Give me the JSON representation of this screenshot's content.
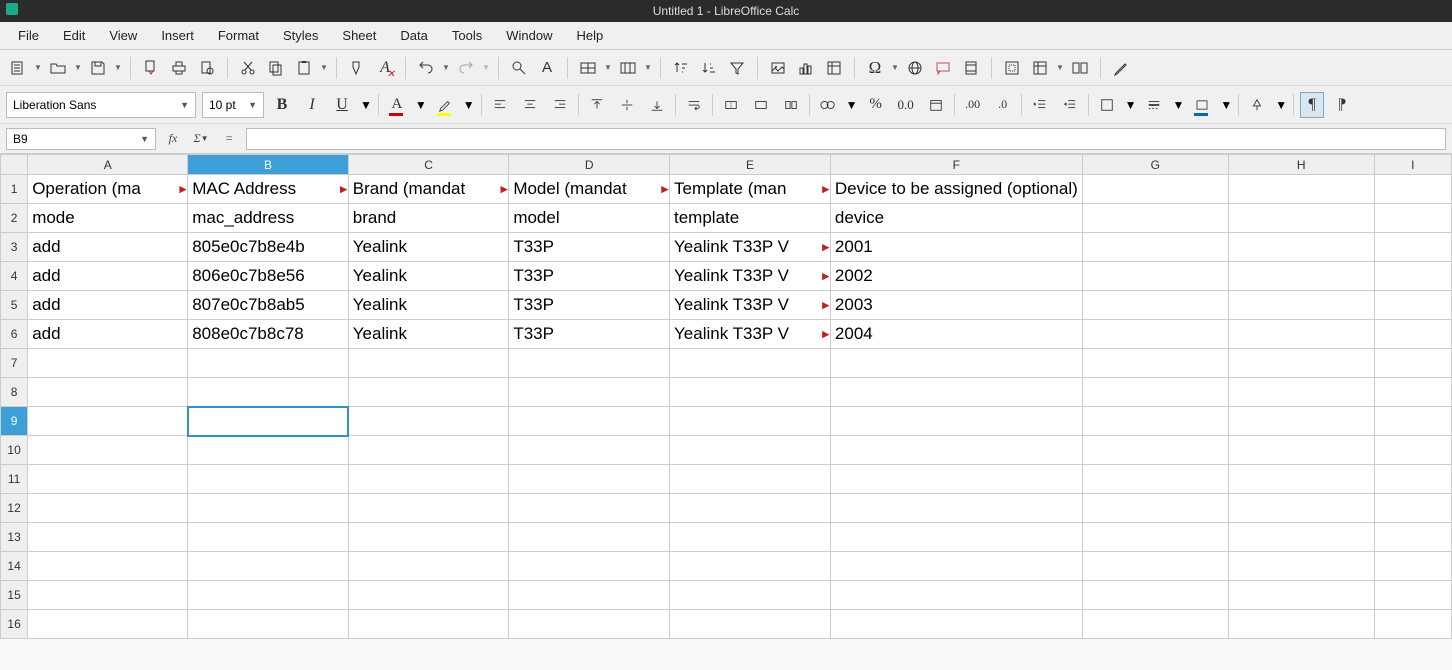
{
  "window": {
    "title": "Untitled 1 - LibreOffice Calc"
  },
  "menu": {
    "items": [
      "File",
      "Edit",
      "View",
      "Insert",
      "Format",
      "Styles",
      "Sheet",
      "Data",
      "Tools",
      "Window",
      "Help"
    ]
  },
  "format": {
    "font_name": "Liberation Sans",
    "font_size": "10 pt"
  },
  "ref": {
    "cell": "B9",
    "formula": ""
  },
  "columns": [
    "A",
    "B",
    "C",
    "D",
    "E",
    "F",
    "G",
    "H",
    "I"
  ],
  "selected": {
    "col": "B",
    "row": 9
  },
  "sheet": {
    "rows": [
      {
        "n": 1,
        "A": "Operation (ma",
        "B": "MAC Address",
        "C": "Brand (mandat",
        "D": "Model (mandat",
        "E": "Template (man",
        "F": "Device to be assigned (optional)",
        "G": "",
        "H": "",
        "overflowA": true,
        "overflowB": true,
        "overflowC": true,
        "overflowD": true,
        "overflowE": true
      },
      {
        "n": 2,
        "A": "mode",
        "B": "mac_address",
        "C": "brand",
        "D": "model",
        "E": "template",
        "F": "device",
        "G": "",
        "H": ""
      },
      {
        "n": 3,
        "A": "add",
        "B": "805e0c7b8e4b",
        "C": "Yealink",
        "D": "T33P",
        "E": "Yealink T33P V",
        "F": "2001",
        "G": "",
        "H": "",
        "overflowE": true,
        "numF": true
      },
      {
        "n": 4,
        "A": "add",
        "B": "806e0c7b8e56",
        "C": "Yealink",
        "D": "T33P",
        "E": "Yealink T33P V",
        "F": "2002",
        "G": "",
        "H": "",
        "overflowE": true,
        "numF": true
      },
      {
        "n": 5,
        "A": "add",
        "B": "807e0c7b8ab5",
        "C": "Yealink",
        "D": "T33P",
        "E": "Yealink T33P V",
        "F": "2003",
        "G": "",
        "H": "",
        "overflowE": true,
        "numF": true
      },
      {
        "n": 6,
        "A": "add",
        "B": "808e0c7b8c78",
        "C": "Yealink",
        "D": "T33P",
        "E": "Yealink T33P V",
        "F": "2004",
        "G": "",
        "H": "",
        "overflowE": true,
        "numF": true
      },
      {
        "n": 7
      },
      {
        "n": 8
      },
      {
        "n": 9
      },
      {
        "n": 10
      },
      {
        "n": 11
      },
      {
        "n": 12
      },
      {
        "n": 13
      },
      {
        "n": 14
      },
      {
        "n": 15
      },
      {
        "n": 16
      }
    ]
  },
  "colwidths": {
    "A": 167,
    "B": 167,
    "C": 167,
    "D": 167,
    "E": 167,
    "F": 167,
    "G": 167,
    "H": 167,
    "I": 88
  }
}
